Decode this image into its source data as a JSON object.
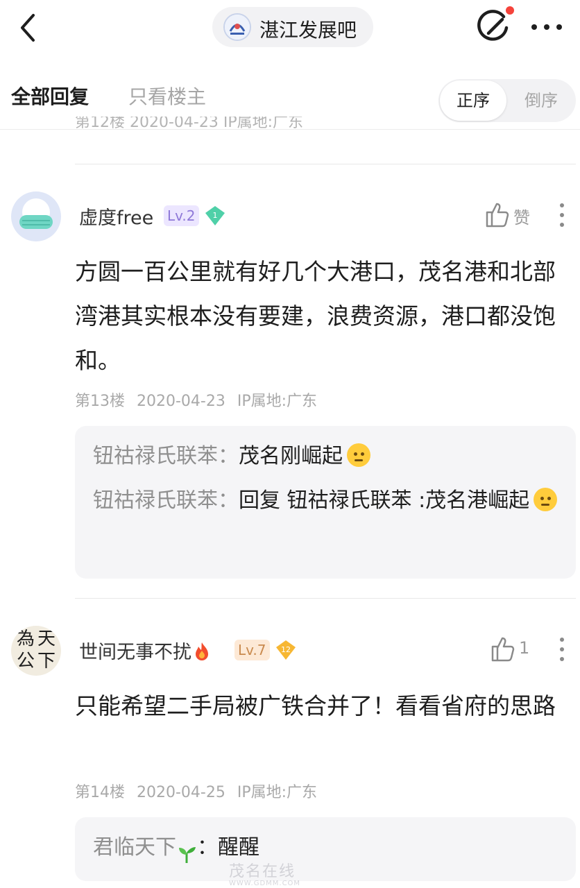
{
  "header": {
    "forum_name": "湛江发展吧"
  },
  "filter": {
    "tab_all": "全部回复",
    "tab_op_only": "只看楼主",
    "sort_asc": "正序",
    "sort_desc": "倒序"
  },
  "previous_meta": "第12楼  2020-04-23  IP属地:广东",
  "posts": [
    {
      "username": "虚度free",
      "level": "Lv.2",
      "gem_number": "1",
      "like_label": "赞",
      "text": "方圆一百公里就有好几个大港口，茂名港和北部湾港其实根本没有要建，浪费资源，港口都没饱和。",
      "floor": "第13楼",
      "date": "2020-04-23",
      "ip": "IP属地:广东",
      "replies": [
        {
          "user": "钮祜禄氏联苯：",
          "text": "茂名刚崛起"
        },
        {
          "user": "钮祜禄氏联苯：",
          "text": "回复 钮祜禄氏联苯 :茂名港崛起"
        }
      ]
    },
    {
      "username": "世间无事不扰",
      "level": "Lv.7",
      "gem_number": "12",
      "like_label": "1",
      "avatar_text": [
        "為",
        "天",
        "公",
        "下"
      ],
      "text": "只能希望二手局被广铁合并了！看看省府的思路",
      "floor": "第14楼",
      "date": "2020-04-25",
      "ip": "IP属地:广东",
      "replies": [
        {
          "user": "君临天下",
          "text": "：醒醒"
        }
      ]
    }
  ],
  "watermark": {
    "main": "茂名在线",
    "sub": "WWW.GDMM.COM"
  },
  "colors": {
    "accent_red": "#f5433b",
    "level2": "#8e78d8",
    "level7": "#c98a4e"
  }
}
